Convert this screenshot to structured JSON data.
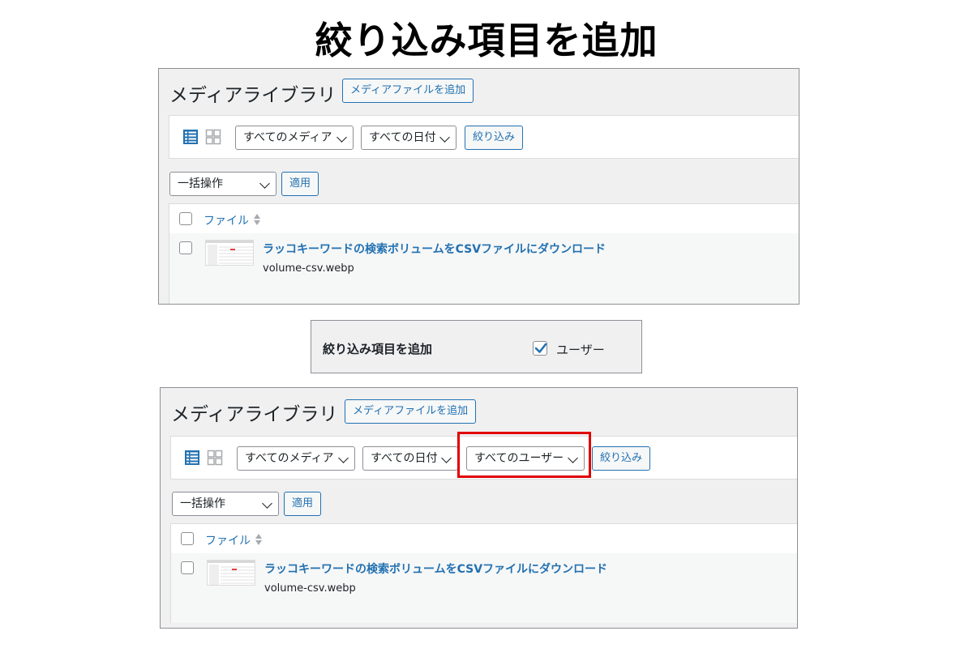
{
  "main_title": "絞り込み項目を追加",
  "before": {
    "page_title": "メディアライブラリ",
    "add_media_button": "メディアファイルを追加",
    "filter_media_select": "すべてのメディア",
    "filter_date_select": "すべての日付",
    "filter_button": "絞り込み",
    "bulk_action_select": "一括操作",
    "apply_button": "適用",
    "column_file": "ファイル",
    "row": {
      "title": "ラッコキーワードの検索ボリュームをCSVファイルにダウンロード",
      "filename": "volume-csv.webp"
    }
  },
  "setting": {
    "label": "絞り込み項目を追加",
    "user_checkbox_label": "ユーザー",
    "user_checked": true
  },
  "after": {
    "page_title": "メディアライブラリ",
    "add_media_button": "メディアファイルを追加",
    "filter_media_select": "すべてのメディア",
    "filter_date_select": "すべての日付",
    "filter_user_select": "すべてのユーザー",
    "filter_button": "絞り込み",
    "bulk_action_select": "一括操作",
    "apply_button": "適用",
    "column_file": "ファイル",
    "row": {
      "title": "ラッコキーワードの検索ボリュームをCSVファイルにダウンロード",
      "filename": "volume-csv.webp"
    }
  },
  "icons": {
    "list_view": "list-view-icon",
    "grid_view": "grid-view-icon",
    "sort": "sort-icon",
    "chevron": "chevron-down-icon",
    "checkmark": "checkmark-icon"
  },
  "colors": {
    "accent": "#2271b1",
    "highlight": "#e00000",
    "panel_bg": "#f0f0f1"
  }
}
